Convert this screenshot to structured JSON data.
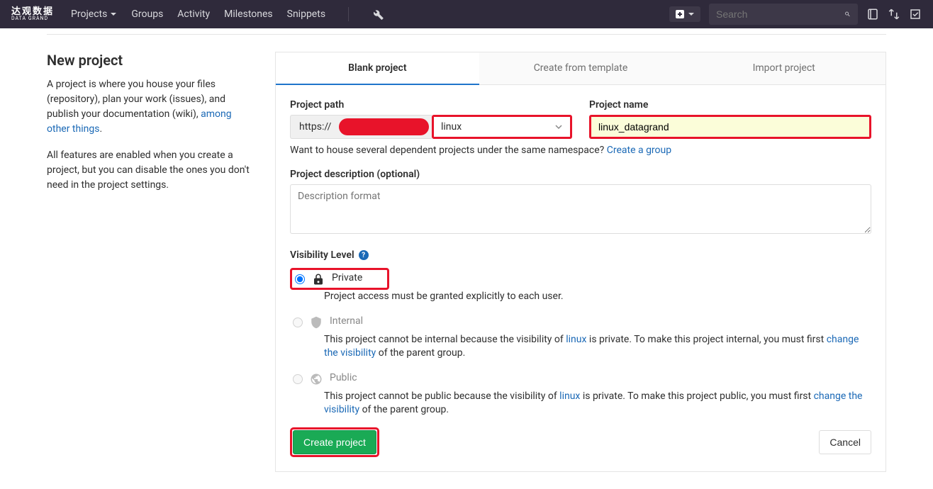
{
  "navbar": {
    "logo_main": "达观数据",
    "logo_sub": "DATA GRAND",
    "links": [
      "Projects",
      "Groups",
      "Activity",
      "Milestones",
      "Snippets"
    ],
    "search_placeholder": "Search"
  },
  "sidebar": {
    "title": "New project",
    "desc_pre": "A project is where you house your files (repository), plan your work (issues), and publish your documentation (wiki), ",
    "desc_link": "among other things",
    "features_text": "All features are enabled when you create a project, but you can disable the ones you don't need in the project settings."
  },
  "tabs": [
    {
      "label": "Blank project",
      "active": true
    },
    {
      "label": "Create from template",
      "active": false
    },
    {
      "label": "Import project",
      "active": false
    }
  ],
  "form": {
    "path_label": "Project path",
    "path_prefix": "https://",
    "namespace_value": "linux",
    "name_label": "Project name",
    "name_value": "linux_datagrand",
    "namespace_help_pre": "Want to house several dependent projects under the same namespace? ",
    "namespace_help_link": "Create a group",
    "desc_label": "Project description (optional)",
    "desc_placeholder": "Description format",
    "visibility_label": "Visibility Level",
    "visibility": {
      "private": {
        "title": "Private",
        "desc": "Project access must be granted explicitly to each user."
      },
      "internal": {
        "title": "Internal",
        "desc_pre": "This project cannot be internal because the visibility of ",
        "desc_link1": "linux",
        "desc_mid": " is private. To make this project internal, you must first ",
        "desc_link2": "change the visibility",
        "desc_post": " of the parent group."
      },
      "public": {
        "title": "Public",
        "desc_pre": "This project cannot be public because the visibility of ",
        "desc_link1": "linux",
        "desc_mid": " is private. To make this project public, you must first ",
        "desc_link2": "change the visibility",
        "desc_post": " of the parent group."
      }
    },
    "create_btn": "Create project",
    "cancel_btn": "Cancel"
  }
}
